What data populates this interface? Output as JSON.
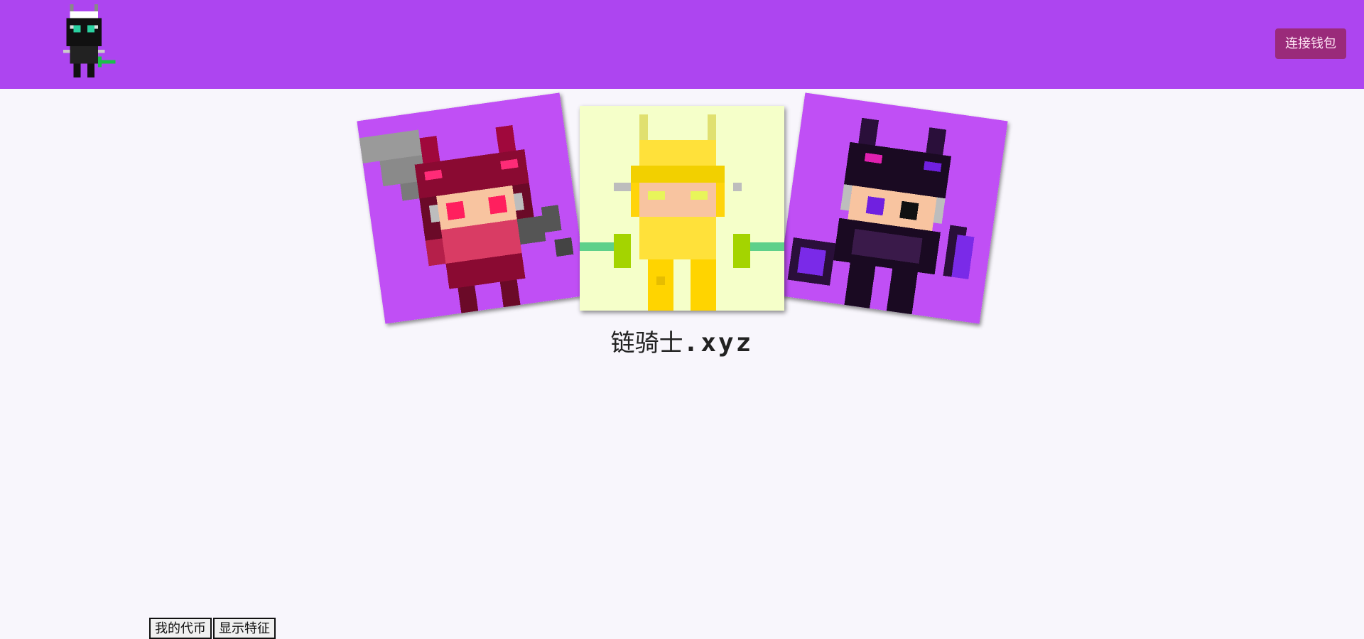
{
  "header": {
    "logo_icon": "pixel-knight-logo-icon",
    "connect_button_label": "连接钱包",
    "background_color": "#ad45f0",
    "button_color": "#9a2a7a"
  },
  "hero": {
    "cards": [
      {
        "icon": "red-knight-with-sword-icon",
        "background": "#c04ff5"
      },
      {
        "icon": "yellow-knight-with-dual-blades-icon",
        "background": "#f5ffc9"
      },
      {
        "icon": "black-knight-with-mace-icon",
        "background": "#c04ff5"
      }
    ]
  },
  "site_title": {
    "name": "链骑士",
    "tld": ".xyz"
  },
  "tabs": [
    {
      "label": "我的代币"
    },
    {
      "label": "显示特征"
    }
  ]
}
